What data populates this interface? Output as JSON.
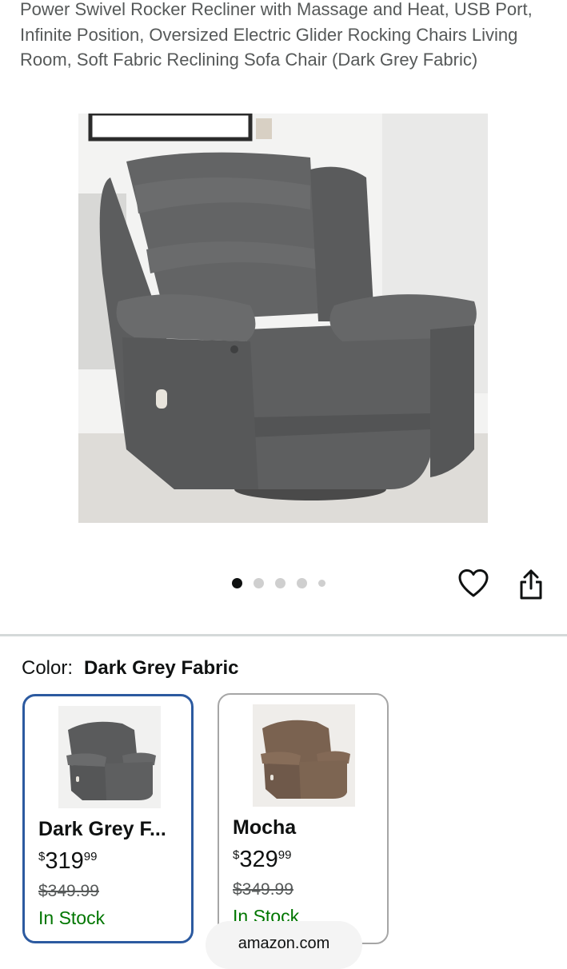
{
  "product": {
    "title": "Power Swivel Rocker Recliner with Massage and Heat, USB Port, Infinite Position, Oversized Electric Glider Rocking Chairs Living Room, Soft Fabric Reclining Sofa Chair (Dark Grey Fabric)"
  },
  "gallery": {
    "image_count": 5,
    "active_index": 0,
    "icons": [
      "heart-icon",
      "share-icon"
    ]
  },
  "color_selector": {
    "label": "Color:",
    "selected": "Dark Grey Fabric"
  },
  "variants": [
    {
      "name": "Dark Grey F...",
      "price_symbol": "$",
      "price_whole": "319",
      "price_fraction": "99",
      "list_price": "$349.99",
      "stock": "In Stock",
      "selected": true,
      "fabric_color": "#5a5b5c"
    },
    {
      "name": "Mocha",
      "price_symbol": "$",
      "price_whole": "329",
      "price_fraction": "99",
      "list_price": "$349.99",
      "stock": "In Stock",
      "selected": false,
      "fabric_color": "#7a6250"
    }
  ],
  "browser": {
    "domain": "amazon.com"
  },
  "colors": {
    "selected_border": "#2c5aa0",
    "in_stock": "#007600",
    "muted_text": "#565959"
  }
}
